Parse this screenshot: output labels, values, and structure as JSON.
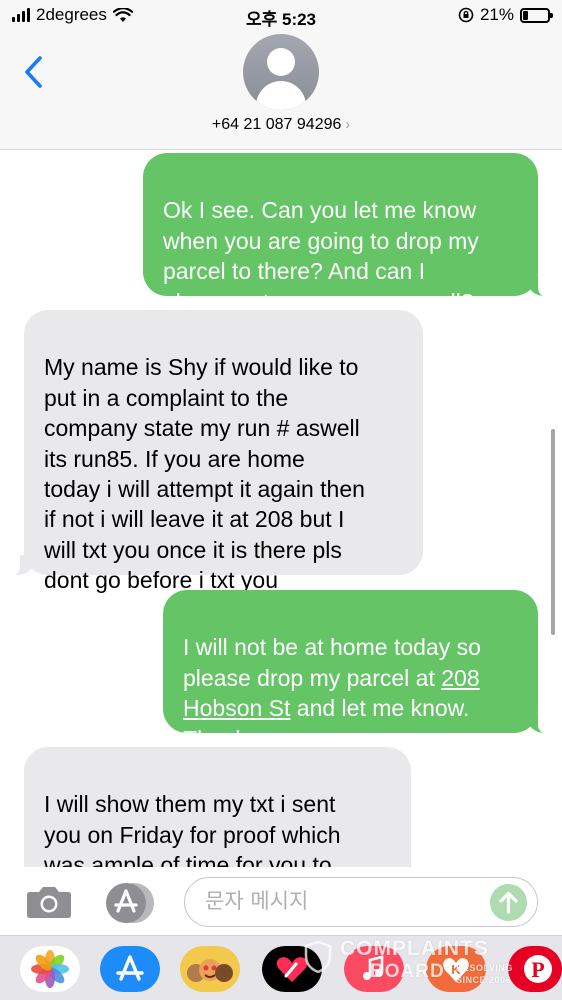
{
  "status_bar": {
    "carrier": "2degrees",
    "time": "오후 5:23",
    "battery_percent_text": "21%",
    "battery_level": 0.21
  },
  "header": {
    "back_icon": "chevron-left-icon",
    "contact": "+64 21 087 94296",
    "contact_chevron": "›"
  },
  "messages": [
    {
      "direction": "outgoing",
      "text": "Ok I see. Can you let me know\nwhen you are going to drop my\nparcel to there? And can I\nplease get your name as well?"
    },
    {
      "direction": "incoming",
      "text": "My name is Shy if would like to\nput in a complaint to the\ncompany state my run # aswell\nits run85.  If you are home\ntoday i will attempt it again then\nif not i will leave it at 208 but I\nwill txt you once it is there pls\ndont go before i txt you"
    },
    {
      "direction": "outgoing",
      "text_before": "I will not be at home today so\nplease drop my parcel at ",
      "link_text": "208\nHobson St",
      "text_after": " and let me know.\nThanks"
    },
    {
      "direction": "incoming",
      "text": "I will show them my txt i sent\nyou on Friday for proof which\nwas ample of time for you to\ncollect your parcel.  I hadnt"
    }
  ],
  "input_bar": {
    "placeholder": "문자 메시지",
    "camera_icon": "camera-icon",
    "apps_icon": "app-store-icon",
    "send_icon": "arrow-up-icon"
  },
  "app_drawer": {
    "apps": [
      "photos-icon",
      "app-store-icon",
      "memoji-icon",
      "digital-touch-icon",
      "music-icon",
      "k-app-icon",
      "pinterest-icon"
    ]
  },
  "watermark": {
    "line1": "COMPLAINTS",
    "line2": "BOARD",
    "tagline_1": "RESOLVING",
    "tagline_2": "SINCE 2006"
  },
  "colors": {
    "outgoing_bubble": "#65c466",
    "incoming_bubble": "#e9e9eb",
    "accent_blue": "#1a7cf5"
  }
}
